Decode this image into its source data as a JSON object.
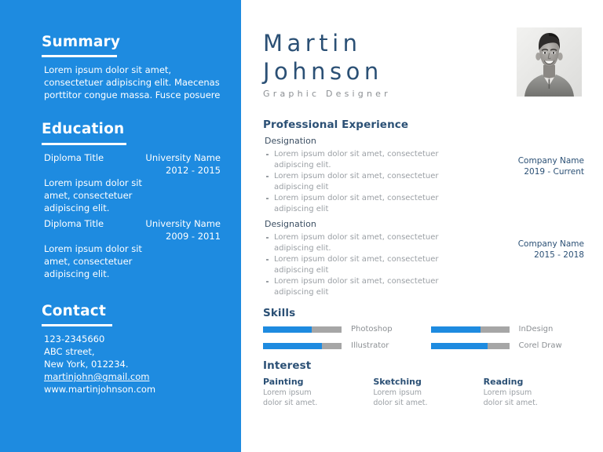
{
  "colors": {
    "sidebar_blue": "#1e8be0",
    "heading_navy": "#2b5075",
    "body_gray": "#9a9fa4",
    "bar_track": "#a6a6a6",
    "bar_fill": "#1e8be0"
  },
  "sidebar": {
    "summary": {
      "heading": "Summary",
      "text": "Lorem ipsum dolor sit amet, consectetuer adipiscing elit. Maecenas porttitor congue massa. Fusce posuere"
    },
    "education": {
      "heading": "Education",
      "items": [
        {
          "title": "Diploma Title",
          "institution": "University Name",
          "years": "2012 - 2015",
          "description": "Lorem ipsum dolor sit amet, consectetuer adipiscing elit."
        },
        {
          "title": "Diploma Title",
          "institution": "University Name",
          "years": "2009 - 2011",
          "description": "Lorem ipsum dolor sit amet, consectetuer adipiscing elit."
        }
      ]
    },
    "contact": {
      "heading": "Contact",
      "phone": "123-2345660",
      "street": "ABC street,",
      "city": "New York, 012234.",
      "email": "martinjohn@gmail.com",
      "website": "www.martinjohnson.com"
    }
  },
  "header": {
    "first_name": "Martin",
    "last_name": "Johnson",
    "job_title": "Graphic Designer",
    "photo_alt": "portrait-photo"
  },
  "experience": {
    "heading": "Professional Experience",
    "entries": [
      {
        "designation": "Designation",
        "bullets": [
          "Lorem ipsum dolor sit amet, consectetuer adipiscing elit.",
          "Lorem ipsum dolor sit amet, consectetuer adipiscing elit",
          "Lorem ipsum dolor sit amet, consectetuer adipiscing elit"
        ],
        "company": "Company Name",
        "period": "2019 - Current"
      },
      {
        "designation": "Designation",
        "bullets": [
          "Lorem ipsum dolor sit amet, consectetuer adipiscing elit.",
          "Lorem ipsum dolor sit amet, consectetuer adipiscing elit",
          "Lorem ipsum dolor sit amet, consectetuer adipiscing elit"
        ],
        "company": "Company Name",
        "period": "2015 - 2018"
      }
    ]
  },
  "skills": {
    "heading": "Skills",
    "items": [
      {
        "label": "Photoshop",
        "level": 62
      },
      {
        "label": "InDesign",
        "level": 63
      },
      {
        "label": "Illustrator",
        "level": 75
      },
      {
        "label": "Corel Draw",
        "level": 72
      }
    ]
  },
  "interest": {
    "heading": "Interest",
    "items": [
      {
        "title": "Painting",
        "text": "Lorem ipsum dolor sit amet."
      },
      {
        "title": "Sketching",
        "text": "Lorem ipsum dolor sit amet."
      },
      {
        "title": "Reading",
        "text": "Lorem ipsum dolor sit amet."
      }
    ]
  }
}
